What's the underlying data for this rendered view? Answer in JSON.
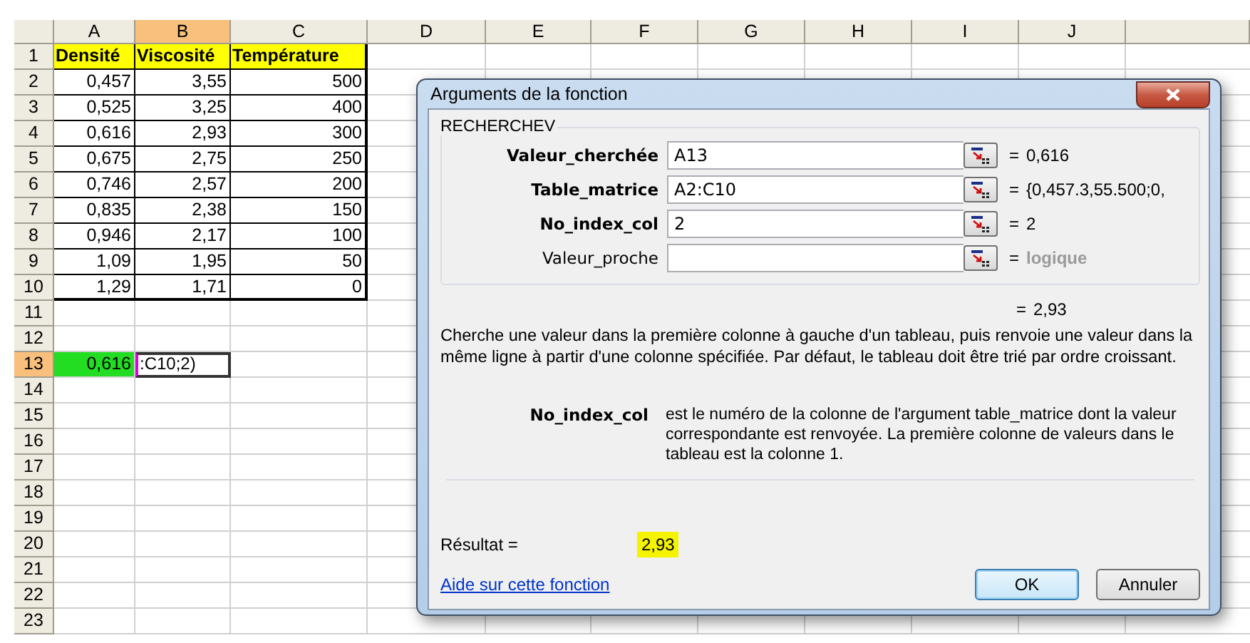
{
  "sheet": {
    "columns": [
      {
        "label": "A",
        "selected": false
      },
      {
        "label": "B",
        "selected": true
      },
      {
        "label": "C",
        "selected": false
      },
      {
        "label": "D",
        "selected": false
      },
      {
        "label": "E",
        "selected": false
      },
      {
        "label": "F",
        "selected": false
      },
      {
        "label": "G",
        "selected": false
      },
      {
        "label": "H",
        "selected": false
      },
      {
        "label": "I",
        "selected": false
      },
      {
        "label": "J",
        "selected": false
      }
    ],
    "rows": [
      {
        "label": "1",
        "selected": false,
        "cells": [
          {
            "kind": "header",
            "text": "Densité"
          },
          {
            "kind": "header",
            "text": "Viscosité"
          },
          {
            "kind": "header",
            "text": "Température"
          }
        ]
      },
      {
        "label": "2",
        "selected": false,
        "cells": [
          {
            "kind": "number",
            "text": "0,457"
          },
          {
            "kind": "number",
            "text": "3,55"
          },
          {
            "kind": "number",
            "text": "500"
          }
        ]
      },
      {
        "label": "3",
        "selected": false,
        "cells": [
          {
            "kind": "number",
            "text": "0,525"
          },
          {
            "kind": "number",
            "text": "3,25"
          },
          {
            "kind": "number",
            "text": "400"
          }
        ]
      },
      {
        "label": "4",
        "selected": false,
        "cells": [
          {
            "kind": "number",
            "text": "0,616"
          },
          {
            "kind": "number",
            "text": "2,93"
          },
          {
            "kind": "number",
            "text": "300"
          }
        ]
      },
      {
        "label": "5",
        "selected": false,
        "cells": [
          {
            "kind": "number",
            "text": "0,675"
          },
          {
            "kind": "number",
            "text": "2,75"
          },
          {
            "kind": "number",
            "text": "250"
          }
        ]
      },
      {
        "label": "6",
        "selected": false,
        "cells": [
          {
            "kind": "number",
            "text": "0,746"
          },
          {
            "kind": "number",
            "text": "2,57"
          },
          {
            "kind": "number",
            "text": "200"
          }
        ]
      },
      {
        "label": "7",
        "selected": false,
        "cells": [
          {
            "kind": "number",
            "text": "0,835"
          },
          {
            "kind": "number",
            "text": "2,38"
          },
          {
            "kind": "number",
            "text": "150"
          }
        ]
      },
      {
        "label": "8",
        "selected": false,
        "cells": [
          {
            "kind": "number",
            "text": "0,946"
          },
          {
            "kind": "number",
            "text": "2,17"
          },
          {
            "kind": "number",
            "text": "100"
          }
        ]
      },
      {
        "label": "9",
        "selected": false,
        "cells": [
          {
            "kind": "number",
            "text": "1,09"
          },
          {
            "kind": "number",
            "text": "1,95"
          },
          {
            "kind": "number",
            "text": "50"
          }
        ]
      },
      {
        "label": "10",
        "selected": false,
        "cells": [
          {
            "kind": "number",
            "text": "1,29"
          },
          {
            "kind": "number",
            "text": "1,71"
          },
          {
            "kind": "number",
            "text": "0"
          }
        ]
      },
      {
        "label": "11",
        "selected": false
      },
      {
        "label": "12",
        "selected": false
      },
      {
        "label": "13",
        "selected": true,
        "cells": [
          {
            "kind": "highlight",
            "text": "0,616"
          },
          {
            "kind": "editing",
            "text": ":C10;2)"
          }
        ]
      },
      {
        "label": "14",
        "selected": false
      },
      {
        "label": "15",
        "selected": false
      },
      {
        "label": "16",
        "selected": false
      },
      {
        "label": "17",
        "selected": false
      },
      {
        "label": "18",
        "selected": false
      },
      {
        "label": "19",
        "selected": false
      },
      {
        "label": "20",
        "selected": false
      },
      {
        "label": "21",
        "selected": false
      },
      {
        "label": "22",
        "selected": false
      },
      {
        "label": "23",
        "selected": false
      }
    ]
  },
  "dialog": {
    "title": "Arguments de la fonction",
    "function_name": "RECHERCHEV",
    "arguments": [
      {
        "label": "Valeur_cherchée",
        "required": true,
        "value": "A13",
        "sign": "=",
        "result": "0,616",
        "result_dimmed": false
      },
      {
        "label": "Table_matrice",
        "required": true,
        "value": "A2:C10",
        "sign": "=",
        "result": "{0,457.3,55.500;0,",
        "result_dimmed": false
      },
      {
        "label": "No_index_col",
        "required": true,
        "value": "2",
        "sign": "=",
        "result": "2",
        "result_dimmed": false
      },
      {
        "label": "Valeur_proche",
        "required": false,
        "sign": "=",
        "result": "logique",
        "result_dimmed": true
      }
    ],
    "formula_sign": "=",
    "formula_result": "2,93",
    "description": "Cherche une valeur dans la première colonne à gauche d'un tableau, puis renvoie une valeur dans la même ligne à partir d'une colonne spécifiée. Par défaut, le tableau doit être trié par ordre croissant.",
    "argument_help": {
      "name": "No_index_col",
      "text": "est le numéro de la colonne de l'argument table_matrice dont la valeur correspondante est renvoyée. La première colonne de valeurs dans le tableau est la colonne 1."
    },
    "result_label": "Résultat =",
    "result_value": "2,93",
    "help_link": "Aide sur cette fonction",
    "buttons": [
      {
        "label": "OK",
        "default": true
      },
      {
        "label": "Annuler",
        "default": false
      }
    ]
  }
}
